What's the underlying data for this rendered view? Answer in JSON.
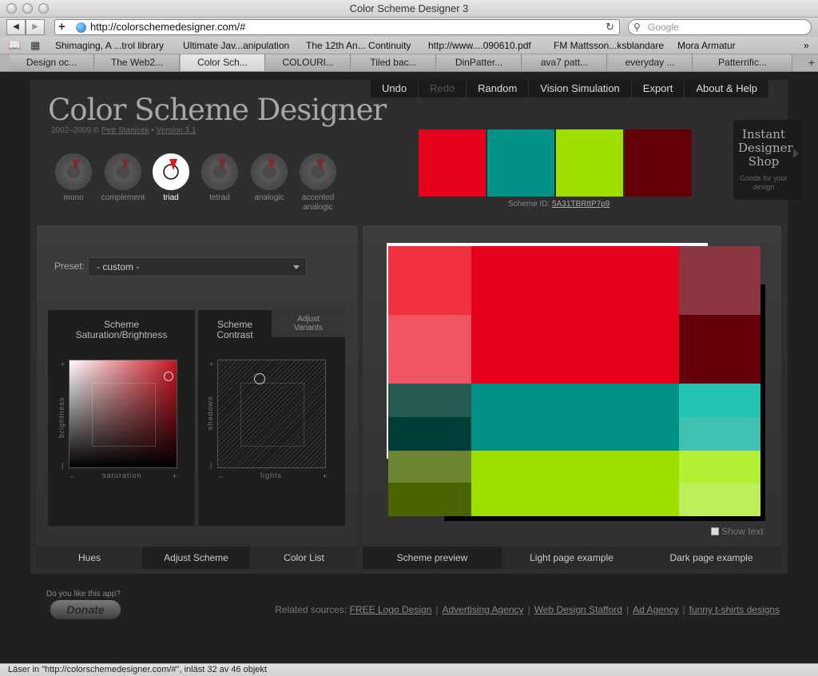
{
  "browser": {
    "window_title": "Color Scheme Designer 3",
    "url": "http://colorschemedesigner.com/#",
    "search_placeholder": "Google",
    "bookmarks": [
      "Shimaging, A ...trol library",
      "Ultimate Jav...anipulation",
      "The 12th An... Continuity",
      "http://www....090610.pdf",
      "FM Mattsson...ksblandare",
      "Mora Armatur"
    ],
    "tabs": [
      "Design oc...",
      "The Web2...",
      "Color Sch...",
      "COLOURl...",
      "Tiled bac...",
      "DinPatter...",
      "ava7 patt...",
      "everyday ...",
      "Patterrific..."
    ],
    "active_tab": 2,
    "status": "Läser in \"http://colorschemedesigner.com/#\", inläst 32 av 46 objekt"
  },
  "app": {
    "menu": [
      "Undo",
      "Redo",
      "Random",
      "Vision Simulation",
      "Export",
      "About & Help"
    ],
    "title": "Color Scheme Designer",
    "copyright_prefix": "2002–2009 ©",
    "author": "Petr Stanicek",
    "bullet": "•",
    "version": "Version 3.1",
    "dials": [
      {
        "label": "mono",
        "active": false
      },
      {
        "label": "complement",
        "active": false
      },
      {
        "label": "triad",
        "active": true
      },
      {
        "label": "tetrad",
        "active": false
      },
      {
        "label": "analogic",
        "active": false
      },
      {
        "label": "accented analogic",
        "active": false
      }
    ],
    "swatches": [
      "#e2001a",
      "#009385",
      "#9fdf00",
      "#660008"
    ],
    "scheme_id_label": "Scheme ID:",
    "scheme_id": "5A31TBRttP7p9",
    "shop": {
      "title": "Instant Designer Shop",
      "subtitle": "Goods for your design"
    },
    "preset_label": "Preset:",
    "preset_value": "- custom -",
    "sat_box_title": "Scheme Saturation/Brightness",
    "axis_brightness": "brightness",
    "axis_saturation": "saturation",
    "axis_shadows": "shadows",
    "axis_lights": "lights",
    "tick_plus": "+",
    "tick_minus": "–",
    "contrast_tab": "Scheme Contrast",
    "variants_tab": "Adjust Variants",
    "left_tabs": [
      "Hues",
      "Adjust Scheme",
      "Color List"
    ],
    "left_active_tab": 1,
    "right_tabs": [
      "Scheme preview",
      "Light page example",
      "Dark page example"
    ],
    "right_active_tab": 0,
    "show_text_label": "Show text",
    "preview_colors": {
      "red": [
        "#f0323e",
        "#ee5663",
        "#e2001a",
        "#8a3540",
        "#660008"
      ],
      "teal": [
        "#245a52",
        "#003d36",
        "#009385",
        "#22c3b0",
        "#40c1b4"
      ],
      "green": [
        "#6d8634",
        "#4a6400",
        "#9fdf00",
        "#b3ef32",
        "#bdee5a"
      ]
    }
  },
  "footer": {
    "like_text": "Do you like this app?",
    "donate": "Donate",
    "related_label": "Related sources:",
    "links": [
      "FREE Logo Design",
      "Advertising Agency",
      "Web Design Stafford",
      "Ad Agency",
      "funny t-shirts designs"
    ],
    "separator": "|"
  }
}
